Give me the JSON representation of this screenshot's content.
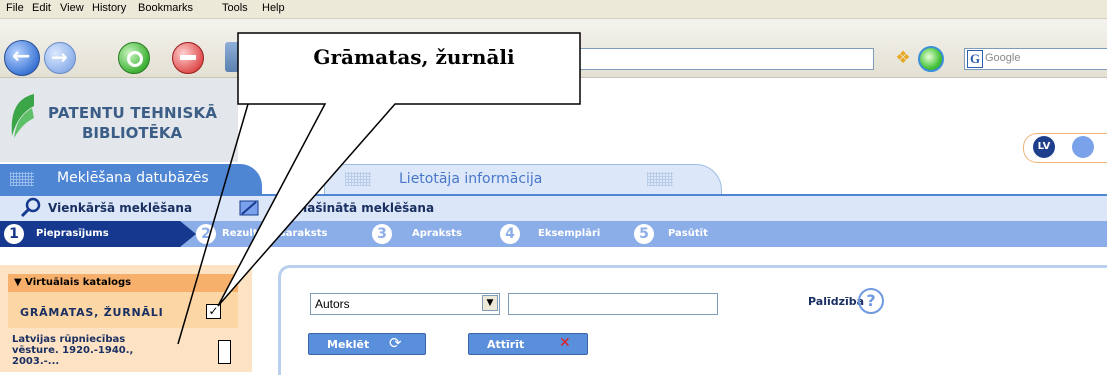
{
  "browser": {
    "menu": [
      "File",
      "Edit",
      "View",
      "History",
      "Bookmarks",
      "Tools",
      "Help"
    ],
    "search_placeholder": "Google",
    "search_engine_icon": "G"
  },
  "site": {
    "logo_line1": "PATENTU TEHNISKĀ",
    "logo_line2": "BIBLIOTĒKA",
    "lang_lv": "LV",
    "colors": {
      "primary": "#4e86d3",
      "dark": "#16388f",
      "sidebar": "#fde3c4",
      "sidebar_head": "#f7b06c"
    }
  },
  "tabs": {
    "main": "Meklēšana datubāzēs",
    "user": "Lietotāja informācija"
  },
  "search_types": {
    "simple": "Vienkāršā meklēšana",
    "advanced": "Paplašinātā meklēšana"
  },
  "steps": [
    {
      "num": "1",
      "label": "Pieprasījums"
    },
    {
      "num": "2",
      "label": "Rezultātu saraksts"
    },
    {
      "num": "3",
      "label": "Apraksts"
    },
    {
      "num": "4",
      "label": "Eksemplāri"
    },
    {
      "num": "5",
      "label": "Pasūtīt"
    }
  ],
  "sidebar": {
    "heading": "▼ Virtuālais katalogs",
    "catalogs": [
      {
        "label": "GRĀMATAS, ŽURNĀLI",
        "checked": true
      },
      {
        "label_lines": [
          "Latvijas rūpniecības",
          "vēsture. 1920.-1940.,",
          "2003.-..."
        ],
        "checked": false
      }
    ]
  },
  "form": {
    "field_value": "Autors",
    "query_value": "",
    "help_label": "Palīdzība",
    "search_label": "Meklēt",
    "clear_label": "Attīrīt"
  },
  "callout": {
    "text": "Grāmatas, žurnāli"
  }
}
